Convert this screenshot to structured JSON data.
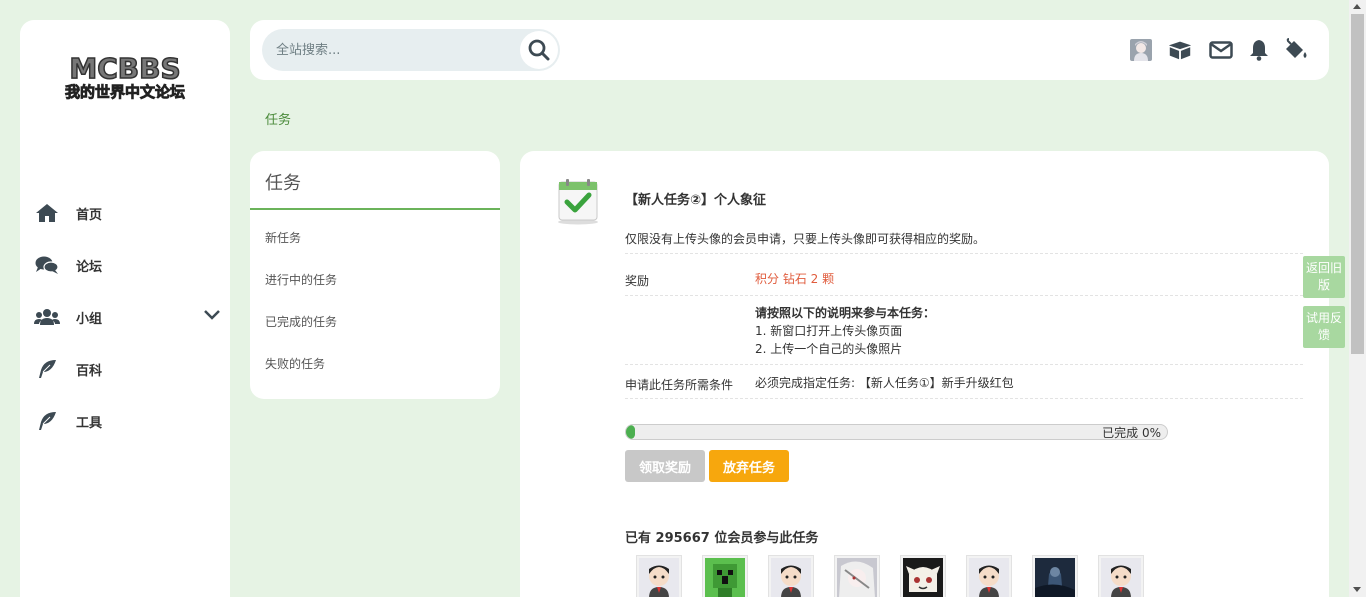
{
  "logo": {
    "text": "MCBBS",
    "subtext": "我的世界中文论坛"
  },
  "search": {
    "placeholder": "全站搜索..."
  },
  "sidebar": {
    "items": [
      {
        "label": "首页",
        "icon": "home-icon"
      },
      {
        "label": "论坛",
        "icon": "comments-icon"
      },
      {
        "label": "小组",
        "icon": "users-icon"
      },
      {
        "label": "百科",
        "icon": "feather-icon"
      },
      {
        "label": "工具",
        "icon": "feather-icon"
      }
    ]
  },
  "header": {
    "icons": [
      "user-avatar-icon",
      "box-icon",
      "mail-icon",
      "bell-icon",
      "paint-bucket-icon"
    ]
  },
  "breadcrumb": "任务",
  "task_menu": {
    "title": "任务",
    "items": [
      "新任务",
      "进行中的任务",
      "已完成的任务",
      "失败的任务"
    ]
  },
  "task": {
    "title": "【新人任务②】个人象征",
    "description": "仅限没有上传头像的会员申请，只要上传头像即可获得相应的奖励。",
    "reward_label": "奖励",
    "reward_value": "积分 钻石 2 颗",
    "steps_title": "请按照以下的说明来参与本任务：",
    "step_1": "1. 新窗口打开上传头像页面",
    "step_2": "2. 上传一个自己的头像照片",
    "requirement_label": "申请此任务所需条件",
    "requirement_value": "必须完成指定任务: 【新人任务①】新手升级红包",
    "progress_percent": 0,
    "progress_text": "已完成 0%",
    "claim_button": "领取奖励",
    "abandon_button": "放弃任务",
    "participants": "已有 295667 位会员参与此任务"
  },
  "floating": {
    "back_old": "返回旧版",
    "feedback": "试用反馈"
  },
  "colors": {
    "accent": "#4a8a3a",
    "orange": "#f7a70d",
    "reward": "#e05c3d",
    "bg": "#e6f3e4"
  }
}
